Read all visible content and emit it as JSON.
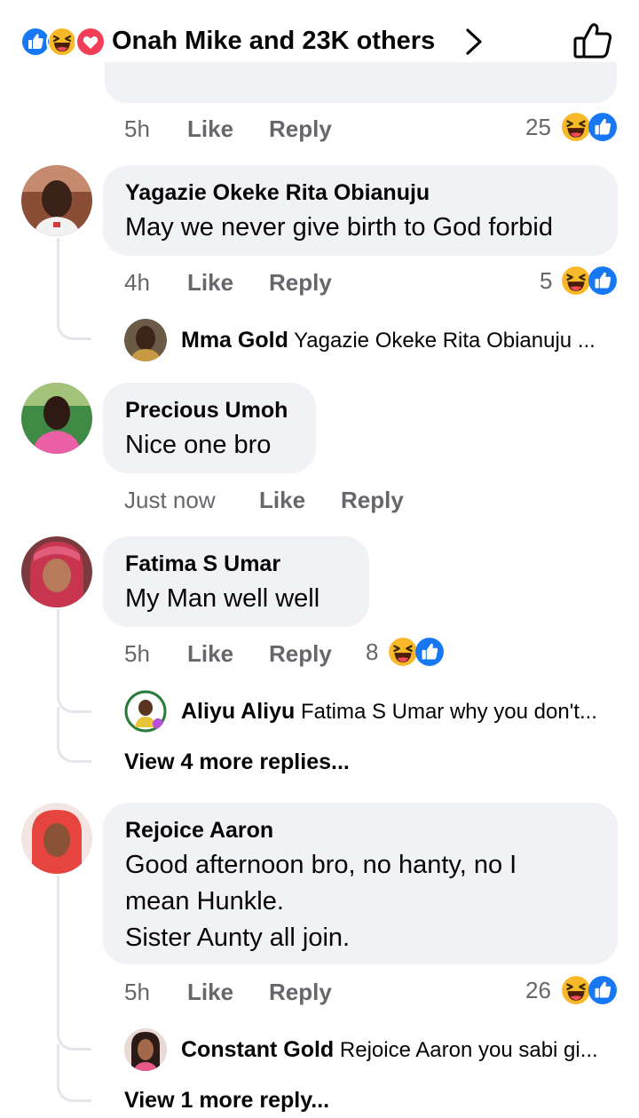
{
  "header": {
    "title": "Onah Mike and 23K others",
    "colors": {
      "like": "#1877f2",
      "haha": "#f7b928",
      "love": "#f33e58"
    }
  },
  "prev_comment": {
    "time": "5h",
    "like": "Like",
    "reply": "Reply",
    "reaction_count": "25"
  },
  "comments": [
    {
      "name": "Yagazie Okeke Rita Obianuju",
      "text": "May we never give birth to God forbid",
      "time": "4h",
      "like": "Like",
      "reply": "Reply",
      "reaction_count": "5",
      "reply_preview": {
        "name": "Mma Gold",
        "text": "Yagazie Okeke Rita Obianuju ..."
      }
    },
    {
      "name": "Precious Umoh",
      "text": "Nice one bro",
      "time": "Just now",
      "like": "Like",
      "reply": "Reply"
    },
    {
      "name": "Fatima S Umar",
      "text": "My Man well well",
      "time": "5h",
      "like": "Like",
      "reply": "Reply",
      "reaction_count": "8",
      "reply_preview": {
        "name": "Aliyu Aliyu",
        "text": "Fatima S Umar why you don't..."
      },
      "view_more": "View 4 more replies..."
    },
    {
      "name": "Rejoice Aaron",
      "text_lines": [
        "Good afternoon bro, no hanty, no I",
        "mean Hunkle.",
        "Sister Aunty all join."
      ],
      "time": "5h",
      "like": "Like",
      "reply": "Reply",
      "reaction_count": "26",
      "reply_preview": {
        "name": "Constant Gold",
        "text": "Rejoice Aaron you sabi gi..."
      },
      "view_more": "View 1 more reply..."
    }
  ]
}
